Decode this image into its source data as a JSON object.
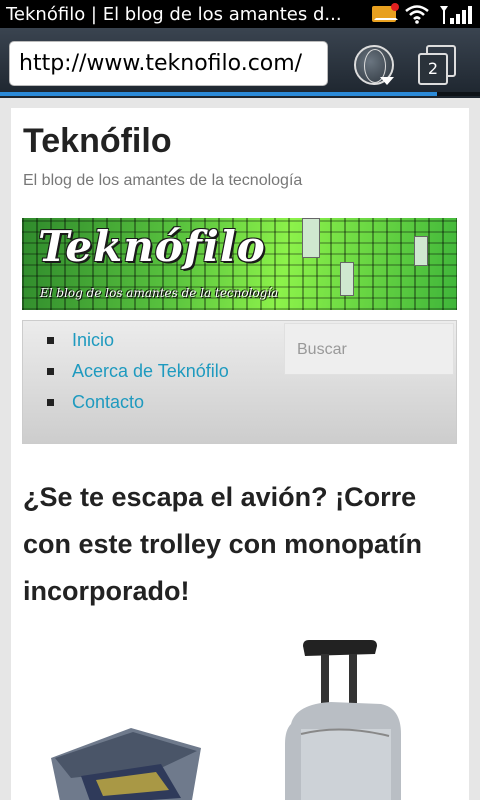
{
  "status_bar": {
    "title": "Teknófilo | El blog de los amantes d...",
    "icons": [
      "mail-icon",
      "wifi-icon",
      "signal-icon"
    ]
  },
  "browser": {
    "url": "http://www.teknofilo.com/",
    "tab_count": "2",
    "load_progress": 0.91
  },
  "site": {
    "title": "Teknófilo",
    "description": "El blog de los amantes de la tecnología",
    "banner_logo_text": "Teknófilo",
    "banner_subtitle": "El blog de los amantes de la tecnología"
  },
  "nav": {
    "items": [
      {
        "label": "Inicio"
      },
      {
        "label": "Acerca de Teknófilo"
      },
      {
        "label": "Contacto"
      }
    ],
    "search_placeholder": "Buscar"
  },
  "post": {
    "title": "¿Se te escapa el avión? ¡Corre con este trolley con monopatín incorporado!"
  },
  "colors": {
    "link": "#1e9abf",
    "progress": "#2b8ad8",
    "banner_green": "#58c23e"
  }
}
